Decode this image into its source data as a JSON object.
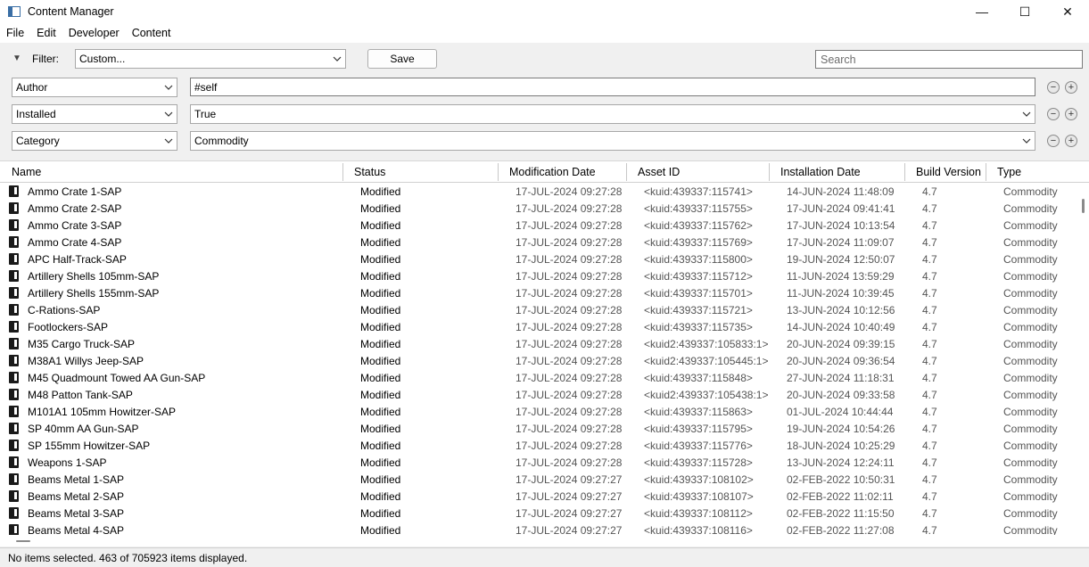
{
  "window": {
    "title": "Content Manager",
    "minimize_glyph": "—",
    "maximize_glyph": "☐",
    "close_glyph": "✕"
  },
  "menu": [
    "File",
    "Edit",
    "Developer",
    "Content"
  ],
  "filter": {
    "toggle_glyph": "▼",
    "label": "Filter:",
    "preset": "Custom...",
    "save_label": "Save",
    "search_placeholder": "Search",
    "rows": [
      {
        "field": "Author",
        "value": "#self",
        "editable": true
      },
      {
        "field": "Installed",
        "value": "True",
        "editable": false
      },
      {
        "field": "Category",
        "value": "Commodity",
        "editable": false
      }
    ],
    "remove_glyph": "−",
    "add_glyph": "+"
  },
  "columns": [
    "Name",
    "Status",
    "Modification Date",
    "Asset ID",
    "Installation Date",
    "Build Version",
    "Type"
  ],
  "rows": [
    {
      "name": "Ammo Crate 1-SAP",
      "status": "Modified",
      "mod": "17-JUL-2024 09:27:28",
      "asset": "<kuid:439337:115741>",
      "inst": "14-JUN-2024 11:48:09",
      "build": "4.7",
      "type": "Commodity"
    },
    {
      "name": "Ammo Crate 2-SAP",
      "status": "Modified",
      "mod": "17-JUL-2024 09:27:28",
      "asset": "<kuid:439337:115755>",
      "inst": "17-JUN-2024 09:41:41",
      "build": "4.7",
      "type": "Commodity"
    },
    {
      "name": "Ammo Crate 3-SAP",
      "status": "Modified",
      "mod": "17-JUL-2024 09:27:28",
      "asset": "<kuid:439337:115762>",
      "inst": "17-JUN-2024 10:13:54",
      "build": "4.7",
      "type": "Commodity"
    },
    {
      "name": "Ammo Crate 4-SAP",
      "status": "Modified",
      "mod": "17-JUL-2024 09:27:28",
      "asset": "<kuid:439337:115769>",
      "inst": "17-JUN-2024 11:09:07",
      "build": "4.7",
      "type": "Commodity"
    },
    {
      "name": "APC Half-Track-SAP",
      "status": "Modified",
      "mod": "17-JUL-2024 09:27:28",
      "asset": "<kuid:439337:115800>",
      "inst": "19-JUN-2024 12:50:07",
      "build": "4.7",
      "type": "Commodity"
    },
    {
      "name": "Artillery Shells 105mm-SAP",
      "status": "Modified",
      "mod": "17-JUL-2024 09:27:28",
      "asset": "<kuid:439337:115712>",
      "inst": "11-JUN-2024 13:59:29",
      "build": "4.7",
      "type": "Commodity"
    },
    {
      "name": "Artillery Shells 155mm-SAP",
      "status": "Modified",
      "mod": "17-JUL-2024 09:27:28",
      "asset": "<kuid:439337:115701>",
      "inst": "11-JUN-2024 10:39:45",
      "build": "4.7",
      "type": "Commodity"
    },
    {
      "name": "C-Rations-SAP",
      "status": "Modified",
      "mod": "17-JUL-2024 09:27:28",
      "asset": "<kuid:439337:115721>",
      "inst": "13-JUN-2024 10:12:56",
      "build": "4.7",
      "type": "Commodity"
    },
    {
      "name": "Footlockers-SAP",
      "status": "Modified",
      "mod": "17-JUL-2024 09:27:28",
      "asset": "<kuid:439337:115735>",
      "inst": "14-JUN-2024 10:40:49",
      "build": "4.7",
      "type": "Commodity"
    },
    {
      "name": "M35 Cargo Truck-SAP",
      "status": "Modified",
      "mod": "17-JUL-2024 09:27:28",
      "asset": "<kuid2:439337:105833:1>",
      "inst": "20-JUN-2024 09:39:15",
      "build": "4.7",
      "type": "Commodity"
    },
    {
      "name": "M38A1 Willys Jeep-SAP",
      "status": "Modified",
      "mod": "17-JUL-2024 09:27:28",
      "asset": "<kuid2:439337:105445:1>",
      "inst": "20-JUN-2024 09:36:54",
      "build": "4.7",
      "type": "Commodity"
    },
    {
      "name": "M45 Quadmount Towed AA Gun-SAP",
      "status": "Modified",
      "mod": "17-JUL-2024 09:27:28",
      "asset": "<kuid:439337:115848>",
      "inst": "27-JUN-2024 11:18:31",
      "build": "4.7",
      "type": "Commodity"
    },
    {
      "name": "M48 Patton Tank-SAP",
      "status": "Modified",
      "mod": "17-JUL-2024 09:27:28",
      "asset": "<kuid2:439337:105438:1>",
      "inst": "20-JUN-2024 09:33:58",
      "build": "4.7",
      "type": "Commodity"
    },
    {
      "name": "M101A1 105mm Howitzer-SAP",
      "status": "Modified",
      "mod": "17-JUL-2024 09:27:28",
      "asset": "<kuid:439337:115863>",
      "inst": "01-JUL-2024 10:44:44",
      "build": "4.7",
      "type": "Commodity"
    },
    {
      "name": "SP 40mm AA Gun-SAP",
      "status": "Modified",
      "mod": "17-JUL-2024 09:27:28",
      "asset": "<kuid:439337:115795>",
      "inst": "19-JUN-2024 10:54:26",
      "build": "4.7",
      "type": "Commodity"
    },
    {
      "name": "SP 155mm Howitzer-SAP",
      "status": "Modified",
      "mod": "17-JUL-2024 09:27:28",
      "asset": "<kuid:439337:115776>",
      "inst": "18-JUN-2024 10:25:29",
      "build": "4.7",
      "type": "Commodity"
    },
    {
      "name": "Weapons 1-SAP",
      "status": "Modified",
      "mod": "17-JUL-2024 09:27:28",
      "asset": "<kuid:439337:115728>",
      "inst": "13-JUN-2024 12:24:11",
      "build": "4.7",
      "type": "Commodity"
    },
    {
      "name": "Beams Metal 1-SAP",
      "status": "Modified",
      "mod": "17-JUL-2024 09:27:27",
      "asset": "<kuid:439337:108102>",
      "inst": "02-FEB-2022 10:50:31",
      "build": "4.7",
      "type": "Commodity"
    },
    {
      "name": "Beams Metal 2-SAP",
      "status": "Modified",
      "mod": "17-JUL-2024 09:27:27",
      "asset": "<kuid:439337:108107>",
      "inst": "02-FEB-2022 11:02:11",
      "build": "4.7",
      "type": "Commodity"
    },
    {
      "name": "Beams Metal 3-SAP",
      "status": "Modified",
      "mod": "17-JUL-2024 09:27:27",
      "asset": "<kuid:439337:108112>",
      "inst": "02-FEB-2022 11:15:50",
      "build": "4.7",
      "type": "Commodity"
    },
    {
      "name": "Beams Metal 4-SAP",
      "status": "Modified",
      "mod": "17-JUL-2024 09:27:27",
      "asset": "<kuid:439337:108116>",
      "inst": "02-FEB-2022 11:27:08",
      "build": "4.7",
      "type": "Commodity"
    }
  ],
  "status_bar": "No items selected. 463 of 705923 items displayed."
}
